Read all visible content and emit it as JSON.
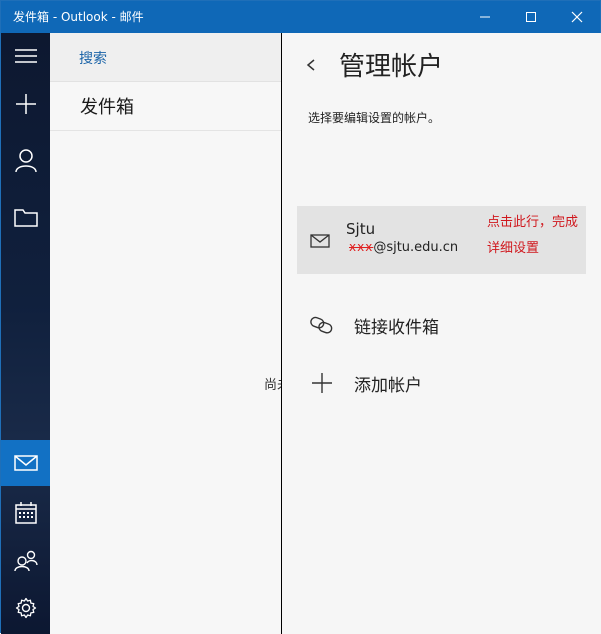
{
  "window": {
    "title": "发件箱 - Outlook - 邮件"
  },
  "rail": {
    "items": [
      {
        "icon": "hamburger-icon"
      },
      {
        "icon": "plus-icon"
      },
      {
        "icon": "person-icon"
      },
      {
        "icon": "folder-icon"
      },
      {
        "icon": "mail-icon",
        "active": true
      },
      {
        "icon": "calendar-icon"
      },
      {
        "icon": "people-icon"
      },
      {
        "icon": "gear-icon"
      }
    ]
  },
  "list": {
    "search_label": "搜索",
    "folder_title": "发件箱",
    "empty_text": "尚未"
  },
  "flyout": {
    "title": "管理帐户",
    "subtitle": "选择要编辑设置的帐户。",
    "account": {
      "name": "Sjtu",
      "email_mask": "xxx",
      "email_domain": "@sjtu.edu.cn"
    },
    "annotation_line1": "点击此行，完成",
    "annotation_line2": "详细设置",
    "link_inbox_label": "链接收件箱",
    "add_account_label": "添加帐户"
  },
  "colors": {
    "titlebar": "#0f68b7",
    "rail_active": "#1271c4",
    "search_text": "#1b64a8",
    "annotation": "#d0181e"
  }
}
